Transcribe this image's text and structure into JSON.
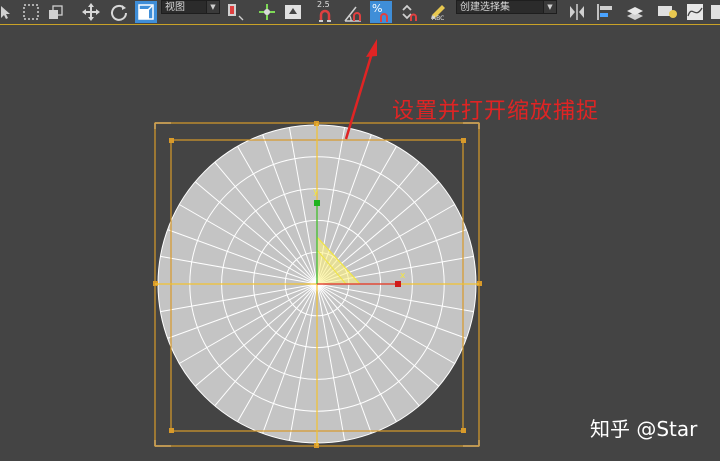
{
  "toolbar": {
    "view_dropdown": "视图",
    "selection_set_dropdown": "创建选择集",
    "snap_angle_value": "2.5",
    "abc_label": "ABC",
    "active_tool": "percent-snap",
    "accent_color": "#3f8ed8"
  },
  "annotation": {
    "text": "设置并打开缩放捕捉",
    "color": "#e02424"
  },
  "watermark": {
    "text": "知乎 @Star"
  },
  "gizmo": {
    "y_label": "y",
    "x_label": "x"
  },
  "object": {
    "type": "cylinder-top-view",
    "radial_segments": 36,
    "rings": 5,
    "fill_color": "#c4c4c4",
    "wire_color": "#ffffff",
    "bbox_color": "#d89a2a"
  }
}
